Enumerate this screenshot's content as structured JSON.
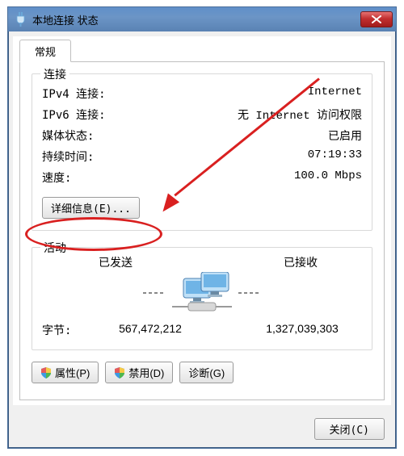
{
  "window": {
    "title": "本地连接 状态"
  },
  "tab": {
    "general": "常规"
  },
  "connection": {
    "legend": "连接",
    "rows": {
      "ipv4_label": "IPv4 连接:",
      "ipv4_value": "Internet",
      "ipv6_label": "IPv6 连接:",
      "ipv6_value": "无 Internet 访问权限",
      "media_label": "媒体状态:",
      "media_value": "已启用",
      "duration_label": "持续时间:",
      "duration_value": "07:19:33",
      "speed_label": "速度:",
      "speed_value": "100.0 Mbps"
    },
    "details_button": "详细信息(E)..."
  },
  "activity": {
    "legend": "活动",
    "sent_label": "已发送",
    "recv_label": "已接收",
    "bytes_label": "字节:",
    "bytes_sent": "567,472,212",
    "bytes_recv": "1,327,039,303"
  },
  "buttons": {
    "properties": "属性(P)",
    "disable": "禁用(D)",
    "diagnose": "诊断(G)",
    "close": "关闭(C)"
  },
  "icons": {
    "plug": "plug-icon",
    "shield": "shield-icon",
    "net": "network-activity-icon"
  }
}
